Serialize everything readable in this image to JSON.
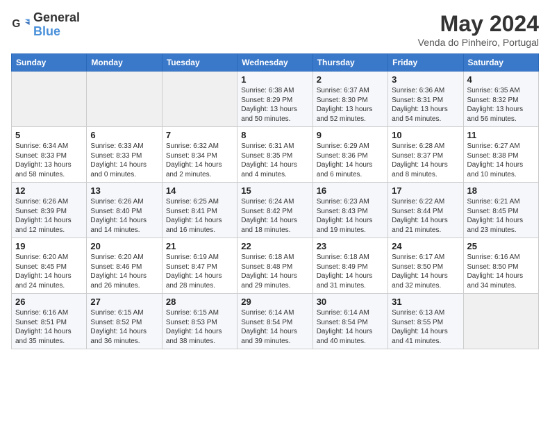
{
  "header": {
    "logo_line1": "General",
    "logo_line2": "Blue",
    "month": "May 2024",
    "location": "Venda do Pinheiro, Portugal"
  },
  "weekdays": [
    "Sunday",
    "Monday",
    "Tuesday",
    "Wednesday",
    "Thursday",
    "Friday",
    "Saturday"
  ],
  "weeks": [
    [
      {
        "day": "",
        "empty": true
      },
      {
        "day": "",
        "empty": true
      },
      {
        "day": "",
        "empty": true
      },
      {
        "day": "1",
        "sunrise": "6:38 AM",
        "sunset": "8:29 PM",
        "daylight": "13 hours and 50 minutes."
      },
      {
        "day": "2",
        "sunrise": "6:37 AM",
        "sunset": "8:30 PM",
        "daylight": "13 hours and 52 minutes."
      },
      {
        "day": "3",
        "sunrise": "6:36 AM",
        "sunset": "8:31 PM",
        "daylight": "13 hours and 54 minutes."
      },
      {
        "day": "4",
        "sunrise": "6:35 AM",
        "sunset": "8:32 PM",
        "daylight": "13 hours and 56 minutes."
      }
    ],
    [
      {
        "day": "5",
        "sunrise": "6:34 AM",
        "sunset": "8:33 PM",
        "daylight": "13 hours and 58 minutes."
      },
      {
        "day": "6",
        "sunrise": "6:33 AM",
        "sunset": "8:33 PM",
        "daylight": "14 hours and 0 minutes."
      },
      {
        "day": "7",
        "sunrise": "6:32 AM",
        "sunset": "8:34 PM",
        "daylight": "14 hours and 2 minutes."
      },
      {
        "day": "8",
        "sunrise": "6:31 AM",
        "sunset": "8:35 PM",
        "daylight": "14 hours and 4 minutes."
      },
      {
        "day": "9",
        "sunrise": "6:29 AM",
        "sunset": "8:36 PM",
        "daylight": "14 hours and 6 minutes."
      },
      {
        "day": "10",
        "sunrise": "6:28 AM",
        "sunset": "8:37 PM",
        "daylight": "14 hours and 8 minutes."
      },
      {
        "day": "11",
        "sunrise": "6:27 AM",
        "sunset": "8:38 PM",
        "daylight": "14 hours and 10 minutes."
      }
    ],
    [
      {
        "day": "12",
        "sunrise": "6:26 AM",
        "sunset": "8:39 PM",
        "daylight": "14 hours and 12 minutes."
      },
      {
        "day": "13",
        "sunrise": "6:26 AM",
        "sunset": "8:40 PM",
        "daylight": "14 hours and 14 minutes."
      },
      {
        "day": "14",
        "sunrise": "6:25 AM",
        "sunset": "8:41 PM",
        "daylight": "14 hours and 16 minutes."
      },
      {
        "day": "15",
        "sunrise": "6:24 AM",
        "sunset": "8:42 PM",
        "daylight": "14 hours and 18 minutes."
      },
      {
        "day": "16",
        "sunrise": "6:23 AM",
        "sunset": "8:43 PM",
        "daylight": "14 hours and 19 minutes."
      },
      {
        "day": "17",
        "sunrise": "6:22 AM",
        "sunset": "8:44 PM",
        "daylight": "14 hours and 21 minutes."
      },
      {
        "day": "18",
        "sunrise": "6:21 AM",
        "sunset": "8:45 PM",
        "daylight": "14 hours and 23 minutes."
      }
    ],
    [
      {
        "day": "19",
        "sunrise": "6:20 AM",
        "sunset": "8:45 PM",
        "daylight": "14 hours and 24 minutes."
      },
      {
        "day": "20",
        "sunrise": "6:20 AM",
        "sunset": "8:46 PM",
        "daylight": "14 hours and 26 minutes."
      },
      {
        "day": "21",
        "sunrise": "6:19 AM",
        "sunset": "8:47 PM",
        "daylight": "14 hours and 28 minutes."
      },
      {
        "day": "22",
        "sunrise": "6:18 AM",
        "sunset": "8:48 PM",
        "daylight": "14 hours and 29 minutes."
      },
      {
        "day": "23",
        "sunrise": "6:18 AM",
        "sunset": "8:49 PM",
        "daylight": "14 hours and 31 minutes."
      },
      {
        "day": "24",
        "sunrise": "6:17 AM",
        "sunset": "8:50 PM",
        "daylight": "14 hours and 32 minutes."
      },
      {
        "day": "25",
        "sunrise": "6:16 AM",
        "sunset": "8:50 PM",
        "daylight": "14 hours and 34 minutes."
      }
    ],
    [
      {
        "day": "26",
        "sunrise": "6:16 AM",
        "sunset": "8:51 PM",
        "daylight": "14 hours and 35 minutes."
      },
      {
        "day": "27",
        "sunrise": "6:15 AM",
        "sunset": "8:52 PM",
        "daylight": "14 hours and 36 minutes."
      },
      {
        "day": "28",
        "sunrise": "6:15 AM",
        "sunset": "8:53 PM",
        "daylight": "14 hours and 38 minutes."
      },
      {
        "day": "29",
        "sunrise": "6:14 AM",
        "sunset": "8:54 PM",
        "daylight": "14 hours and 39 minutes."
      },
      {
        "day": "30",
        "sunrise": "6:14 AM",
        "sunset": "8:54 PM",
        "daylight": "14 hours and 40 minutes."
      },
      {
        "day": "31",
        "sunrise": "6:13 AM",
        "sunset": "8:55 PM",
        "daylight": "14 hours and 41 minutes."
      },
      {
        "day": "",
        "empty": true
      }
    ]
  ]
}
